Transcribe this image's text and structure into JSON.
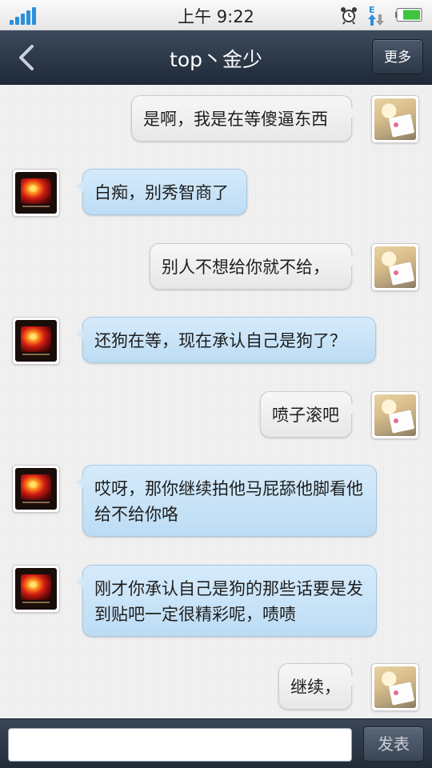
{
  "status_bar": {
    "time": "上午 9:22",
    "signal_icon": "signal-strength-icon",
    "alarm_icon": "alarm-clock-icon",
    "data_icon": "edge-data-icon",
    "battery_icon": "battery-icon",
    "signal_color": "#2a8fdc",
    "battery_color": "#3ec43e"
  },
  "header": {
    "back_icon": "chevron-left-icon",
    "title": "top丶金少",
    "more_label": "更多"
  },
  "messages": [
    {
      "sender": "self",
      "text": "是啊，我是在等傻逼东西"
    },
    {
      "sender": "other",
      "text": "白痴，别秀智商了"
    },
    {
      "sender": "self",
      "text": "别人不想给你就不给，"
    },
    {
      "sender": "other",
      "text": "还狗在等，现在承认自己是狗了？"
    },
    {
      "sender": "self",
      "text": "喷子滚吧"
    },
    {
      "sender": "other",
      "text": "哎呀，那你继续拍他马屁舔他脚看他给不给你咯"
    },
    {
      "sender": "other",
      "text": "刚才你承认自己是狗的那些话要是发到贴吧一定很精彩呢，啧啧"
    },
    {
      "sender": "self",
      "text": "继续，"
    }
  ],
  "composer": {
    "input_value": "",
    "send_label": "发表"
  },
  "colors": {
    "incoming_bubble": "#c6e2f7",
    "outgoing_bubble": "#ececec",
    "header_bg": "#2b3746"
  }
}
